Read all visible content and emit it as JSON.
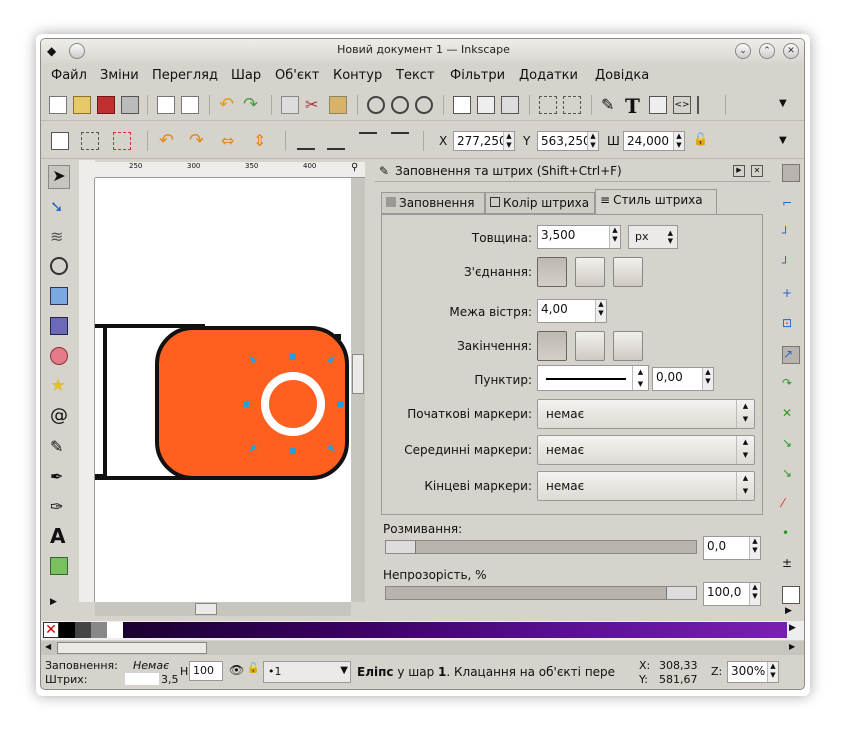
{
  "window": {
    "title": "Новий документ 1 — Inkscape"
  },
  "menu": [
    "Файл",
    "Зміни",
    "Перегляд",
    "Шар",
    "Об'єкт",
    "Контур",
    "Текст",
    "Фільтри",
    "Додатки",
    "Довідка"
  ],
  "toolcontrols": {
    "x_label": "X",
    "x": "277,250",
    "y_label": "Y",
    "y": "563,250",
    "w_label": "Ш",
    "w": "24,000"
  },
  "ruler": [
    "250",
    "300",
    "350",
    "400"
  ],
  "dialog": {
    "title": "Заповнення та штрих (Shift+Ctrl+F)",
    "tabs": [
      "Заповнення",
      "Колір штриха",
      "Стиль штриха"
    ],
    "width_label": "Товщина:",
    "width_value": "3,500",
    "width_unit": "px",
    "join_label": "З'єднання:",
    "miter_label": "Межа вістря:",
    "miter_value": "4,00",
    "cap_label": "Закінчення:",
    "dash_label": "Пунктир:",
    "dash_offset": "0,00",
    "start_label": "Початкові маркери:",
    "mid_label": "Серединні маркери:",
    "end_label": "Кінцеві маркери:",
    "marker_none": "немає",
    "blur_label": "Розмивання:",
    "blur_value": "0,0",
    "blur_level": 0,
    "opacity_label": "Непрозорість, %",
    "opacity_value": "100,0",
    "opacity_level": 1.0
  },
  "status": {
    "fill_label": "Заповнення:",
    "fill_value": "Немає",
    "stroke_label": "Штрих:",
    "stroke_value": "3,5",
    "h_label": "H:",
    "h_value": "100",
    "layer": "•1",
    "message_bold": "Еліпс",
    "message": " у шар ",
    "message_layer": "1",
    "message_rest": ". Клацання на об'єкті пере",
    "x_label": "X:",
    "x": "308,33",
    "y_label": "Y:",
    "y": "581,67",
    "zoom_label": "Z:",
    "zoom": "300%"
  },
  "colors": {
    "shape": "#ff6020",
    "handle": "#22a0d8",
    "accent": "#f0d050"
  }
}
